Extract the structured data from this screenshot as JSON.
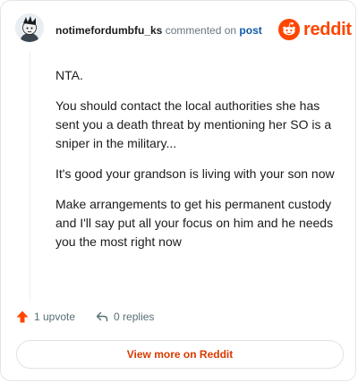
{
  "colors": {
    "brand": "#ff4500",
    "link": "#0f5aa8",
    "muted": "#6a7680",
    "cta_text": "#d93a00"
  },
  "header": {
    "username": "notimefordumbfu_ks",
    "commented_text": "commented on",
    "post_link_label": "post",
    "brand_name": "reddit",
    "avatar_icon": "user-avatar",
    "brand_icon": "reddit-snoo-icon"
  },
  "comment": {
    "paragraphs": [
      "NTA.",
      "You should contact the local authorities she has sent you a death threat by mentioning her SO is a sniper in the military...",
      "It's good your grandson is living with your son now",
      "Make arrangements to get his permanent custody and I'll say put all your focus on him and he needs you the most right now"
    ]
  },
  "actions": {
    "upvote_icon": "upvote-arrow-icon",
    "upvotes_label": "1 upvote",
    "reply_icon": "reply-arrow-icon",
    "replies_label": "0 replies"
  },
  "cta": {
    "label": "View more on Reddit"
  }
}
